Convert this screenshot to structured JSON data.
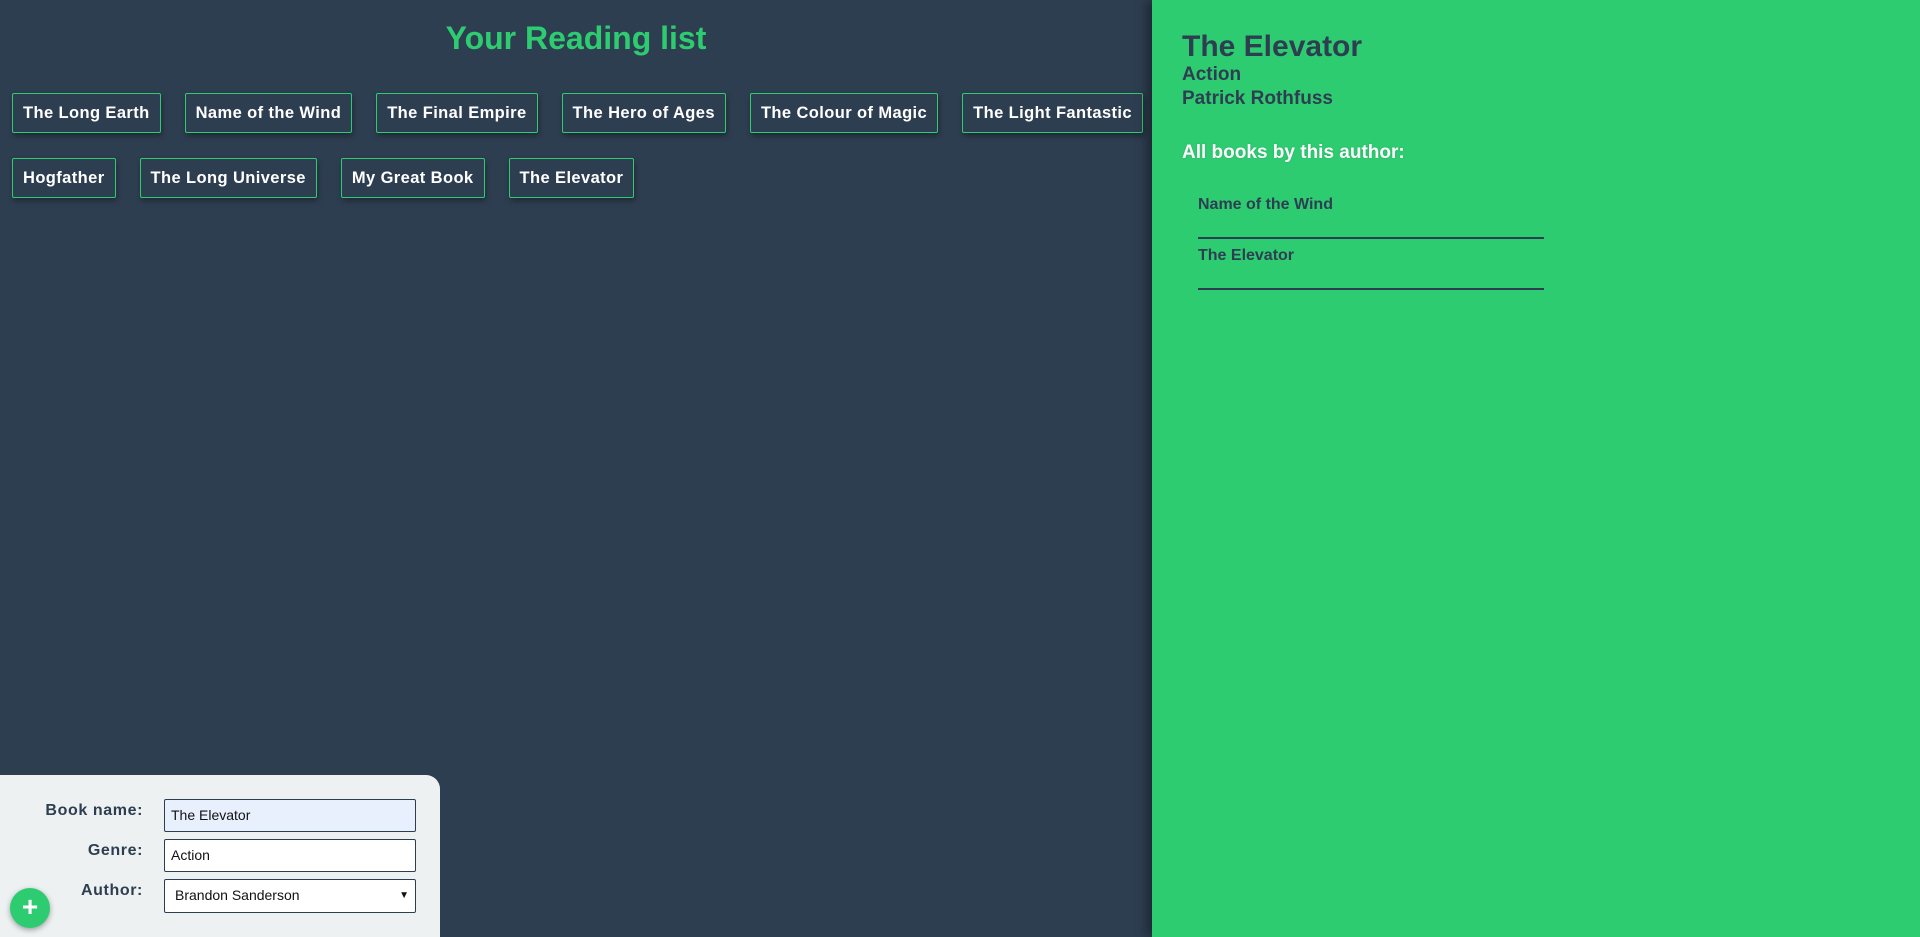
{
  "app": {
    "title": "Your Reading list"
  },
  "books": {
    "row1": [
      "The Long Earth",
      "Name of the Wind",
      "The Final Empire",
      "The Hero of Ages",
      "The Colour of Magic",
      "The Light Fantastic"
    ],
    "row2": [
      "Hogfather",
      "The Long Universe",
      "My Great Book",
      "The Elevator"
    ]
  },
  "details": {
    "title": "The Elevator",
    "genre": "Action",
    "author": "Patrick Rothfuss",
    "heading": "All books by this author:",
    "books": [
      "Name of the Wind",
      "The Elevator"
    ]
  },
  "form": {
    "book_name_label": "Book name:",
    "book_name_value": "The Elevator",
    "genre_label": "Genre:",
    "genre_value": "Action",
    "author_label": "Author:",
    "author_selected": "Brandon Sanderson",
    "add_icon": "+"
  },
  "colors": {
    "background": "#2e3e51",
    "accent": "#2ecc71",
    "form_background": "#eef1f2"
  },
  "icons": {
    "add": "plus-icon",
    "select": "chevron-down-icon"
  }
}
